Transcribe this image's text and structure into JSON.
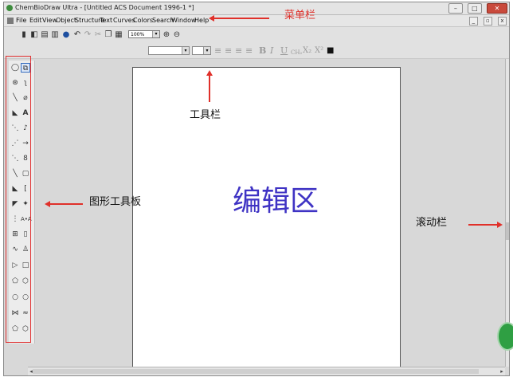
{
  "window": {
    "title": "ChemBioDraw Ultra - [Untitled ACS Document 1996-1 *]",
    "controls": [
      "–",
      "□",
      "✕"
    ]
  },
  "menubar": {
    "items": [
      "File",
      "Edit",
      "View",
      "Object",
      "Structure",
      "Text",
      "Curves",
      "Colors",
      "Search",
      "Window",
      "Help"
    ],
    "mdi_controls": [
      "_",
      "▫",
      "x"
    ]
  },
  "toolbar": {
    "zoom_value": "100%",
    "dropdown_arrow": "▾",
    "icons": [
      "new-icon",
      "open-icon",
      "save-icon",
      "print-icon",
      "help-icon",
      "undo-icon",
      "redo-icon",
      "cut-icon",
      "copy-icon",
      "paste-icon",
      "zoom-in-icon",
      "zoom-out-icon"
    ]
  },
  "format_toolbar": {
    "bold": "B",
    "italic": "I",
    "underline": "U",
    "formula": "CH₂",
    "subscript": "X₂",
    "superscript": "X²"
  },
  "palette": {
    "tools": [
      [
        "lasso-icon",
        "marquee-icon"
      ],
      [
        "rotate-icon",
        "structure-perspective-icon"
      ],
      [
        "solid-bond-icon",
        "eraser-icon"
      ],
      [
        "wedge-bond-icon",
        "text-icon"
      ],
      [
        "dashed-bond-icon",
        "pen-icon"
      ],
      [
        "hashed-bond-icon",
        "arrow-icon"
      ],
      [
        "bold-bond-icon",
        "orbital-icon"
      ],
      [
        "thick-bond-icon",
        "drawing-element-icon"
      ],
      [
        "wedged-hash-icon",
        "bracket-icon"
      ],
      [
        "hashed-wedge-icon",
        "chemical-symbol-icon"
      ],
      [
        "chain-icon",
        "query-icon"
      ],
      [
        "table-icon",
        "tlc-plate-icon"
      ],
      [
        "acyclic-chain-icon",
        "template-icon"
      ],
      [
        "cyclopropane-icon",
        "cyclobutane-icon"
      ],
      [
        "cyclopentane-icon",
        "cyclohexane-icon"
      ],
      [
        "cycloheptane-icon",
        "cyclooctane-icon"
      ],
      [
        "chair-icon",
        "chair-alt-icon"
      ],
      [
        "cyclopentadiene-icon",
        "benzene-icon"
      ]
    ]
  },
  "annotations": {
    "menu_bar": "菜单栏",
    "toolbar": "工具栏",
    "tool_palette": "图形工具板",
    "scrollbar": "滚动栏",
    "edit_area": "编辑区"
  },
  "colors": {
    "annotation_red": "#e0302a",
    "edit_area_label": "#3f33c4"
  }
}
